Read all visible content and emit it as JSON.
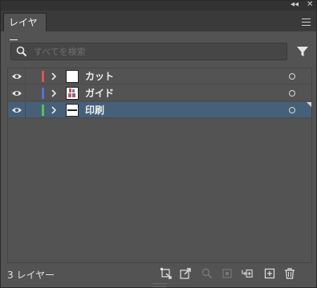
{
  "window": {
    "collapse_glyph": "◂◂",
    "close_glyph": "✕"
  },
  "tab": {
    "label": "レイヤー"
  },
  "search": {
    "placeholder": "すべてを検索",
    "value": ""
  },
  "layers": [
    {
      "name": "カット",
      "color": "#e0505a",
      "selected": false,
      "visible": true,
      "thumb": "blank"
    },
    {
      "name": "ガイド",
      "color": "#5a6fd8",
      "selected": false,
      "visible": true,
      "thumb": "figures"
    },
    {
      "name": "印刷",
      "color": "#5cc04c",
      "selected": true,
      "visible": true,
      "thumb": "text-strip"
    }
  ],
  "footer": {
    "count_label": "3 レイヤー",
    "icons": [
      "collect-for-export-icon",
      "export-icon",
      "locate-object-icon",
      "make-clipping-mask-icon",
      "new-sublayer-icon",
      "new-layer-icon",
      "delete-icon"
    ]
  },
  "colors": {
    "panel_bg": "#535353",
    "selected_row": "#46607a",
    "tab_bar_bg": "#3a3a3a"
  }
}
